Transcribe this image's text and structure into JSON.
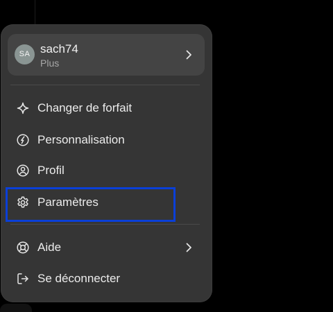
{
  "account": {
    "avatar_initials": "SA",
    "username": "sach74",
    "plan": "Plus"
  },
  "menu": {
    "items": [
      {
        "label": "Changer de forfait",
        "icon": "sparkle-icon"
      },
      {
        "label": "Personnalisation",
        "icon": "personalize-icon"
      },
      {
        "label": "Profil",
        "icon": "user-circle-icon"
      },
      {
        "label": "Paramètres",
        "icon": "gear-icon"
      }
    ],
    "secondary_items": [
      {
        "label": "Aide",
        "icon": "lifebuoy-icon"
      },
      {
        "label": "Se déconnecter",
        "icon": "logout-icon"
      }
    ]
  },
  "colors": {
    "menu_background": "#353535",
    "account_background": "#444444",
    "highlight_border": "#0a3fd8",
    "text": "#ececec",
    "muted_text": "#a8a8a8",
    "avatar": "#8a9593"
  }
}
